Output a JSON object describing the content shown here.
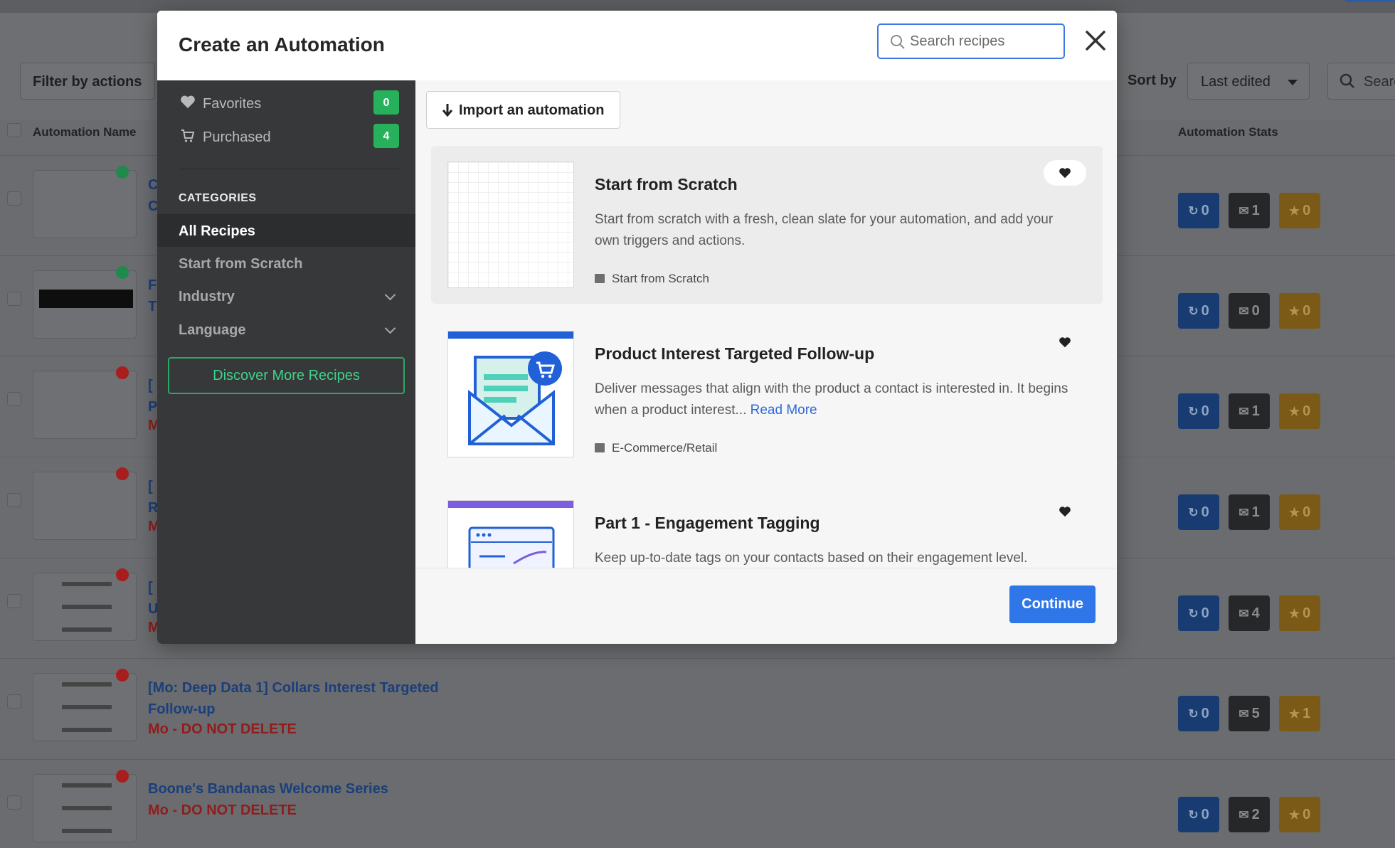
{
  "background": {
    "filter_label": "Filter by actions",
    "sort_label": "Sort by",
    "sort_value": "Last edited",
    "search_placeholder": "Searc",
    "col_name": "Automation Name",
    "col_stats": "Automation Stats",
    "rows": [
      {
        "title": "C",
        "title2": "C",
        "sub": "",
        "dot": "#1f8a4c",
        "stats": [
          "0",
          "1",
          "0"
        ]
      },
      {
        "title": "F",
        "title2": "T",
        "sub": "",
        "dot": "#1f8a4c",
        "stats": [
          "0",
          "0",
          "0"
        ]
      },
      {
        "title": "[",
        "title2": "P",
        "sub": "M",
        "dot": "#a81d1d",
        "stats": [
          "0",
          "1",
          "0"
        ]
      },
      {
        "title": "[",
        "title2": "R",
        "sub": "M",
        "dot": "#a81d1d",
        "stats": [
          "0",
          "1",
          "0"
        ]
      },
      {
        "title": "[",
        "title2": "U",
        "sub": "M",
        "dot": "#a81d1d",
        "stats": [
          "0",
          "4",
          "0"
        ]
      },
      {
        "title": "[Mo: Deep Data 1] Collars Interest Targeted",
        "title2": "Follow-up",
        "sub": "Mo - DO NOT DELETE",
        "dot": "#a81d1d",
        "stats": [
          "0",
          "5",
          "1"
        ]
      },
      {
        "title": "Boone's Bandanas Welcome Series",
        "title2": "",
        "sub": "Mo - DO NOT DELETE",
        "dot": "#a81d1d",
        "stats": [
          "0",
          "2",
          "0"
        ]
      }
    ]
  },
  "modal": {
    "title": "Create an Automation",
    "search_placeholder": "Search recipes",
    "sidebar": {
      "favorites_label": "Favorites",
      "favorites_count": "0",
      "purchased_label": "Purchased",
      "purchased_count": "4",
      "categories_heading": "CATEGORIES",
      "items": [
        "All Recipes",
        "Start from Scratch",
        "Industry",
        "Language"
      ],
      "discover_label": "Discover More Recipes"
    },
    "import_label": "Import an automation",
    "recipes": [
      {
        "title": "Start from Scratch",
        "desc": "Start from scratch with a fresh, clean slate for your automation, and add your own triggers and actions.",
        "read_more": "",
        "tag": "Start from Scratch"
      },
      {
        "title": "Product Interest Targeted Follow-up",
        "desc": "Deliver messages that align with the product a contact is interested in. It begins when a product interest...",
        "read_more": "Read More",
        "tag": "E-Commerce/Retail"
      },
      {
        "title": "Part 1 - Engagement Tagging",
        "desc": "Keep up-to-date tags on your contacts based on their engagement level.",
        "read_more": "",
        "tag": ""
      }
    ],
    "continue_label": "Continue"
  },
  "colors": {
    "primary": "#2f76e8",
    "success": "#27b15c",
    "sidebar_bg": "#373839"
  },
  "icons": [
    "search-icon",
    "close-icon",
    "heart-icon",
    "cart-icon",
    "chevron-down-icon",
    "download-arrow-icon",
    "category-icon"
  ]
}
